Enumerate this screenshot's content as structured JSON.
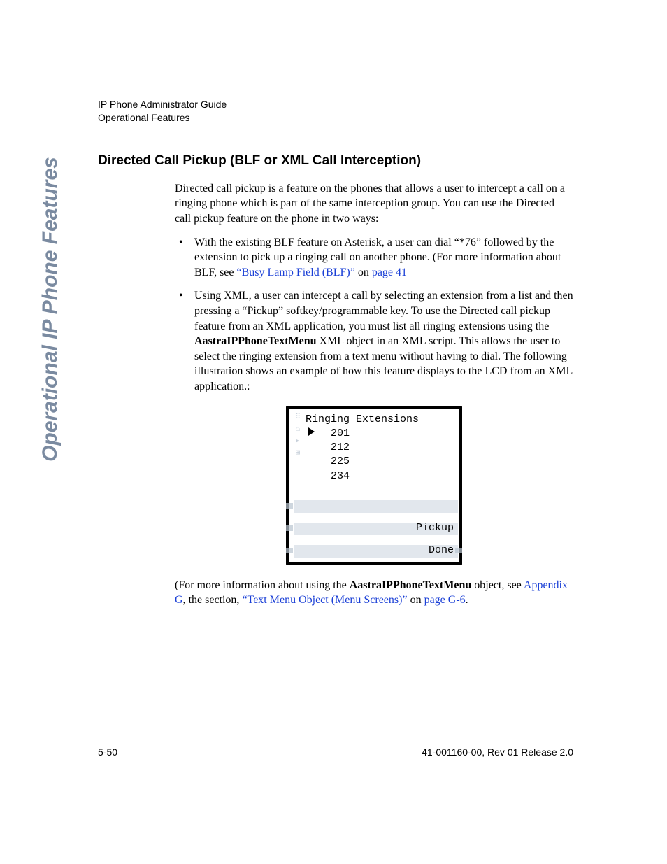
{
  "header": {
    "title": "IP Phone Administrator Guide",
    "subtitle": "Operational Features"
  },
  "sideLabel": "Operational IP Phone Features",
  "section": {
    "title": "Directed Call Pickup (BLF or XML Call Interception)",
    "intro": "Directed call pickup is a feature on the phones that allows a user to intercept a call on a ringing phone which is part of the same interception group. You can use the Directed call pickup feature on the phone in two ways:",
    "bullet1_a": "With the existing BLF feature on Asterisk, a user can dial “*76” followed by the extension to pick up a ringing call on another phone. (For more information about BLF, see ",
    "bullet1_link1": "“Busy Lamp Field (BLF)”",
    "bullet1_b": " on ",
    "bullet1_link2": "page 41",
    "bullet2_a": "Using XML, a user can intercept a call by selecting an extension from a list and then pressing a “Pickup” softkey/programmable key. To use the Directed call pickup feature from an XML application, you must list all ringing extensions using the ",
    "bullet2_bold": "AastraIPPhoneTextMenu",
    "bullet2_b": " XML object in an XML script. This allows the user to select the ringing extension from a text menu without having to dial. The following illustration shows an example of how this feature displays to the LCD from an XML application.:",
    "after_a": "(For more information about using the ",
    "after_bold": "AastraIPPhoneTextMenu",
    "after_b": " object, see ",
    "after_link1": "Appendix G",
    "after_c": ", the section, ",
    "after_link2": "“Text Menu Object (Menu Screens)”",
    "after_d": " on ",
    "after_link3": "page G-6",
    "after_e": "."
  },
  "lcd": {
    "title": "Ringing Extensions",
    "extensions": [
      "201",
      "212",
      "225",
      "234"
    ],
    "softkeys": {
      "pickup": "Pickup",
      "done": "Done"
    }
  },
  "footer": {
    "pageNum": "5-50",
    "docRev": "41-001160-00, Rev 01 Release 2.0"
  }
}
